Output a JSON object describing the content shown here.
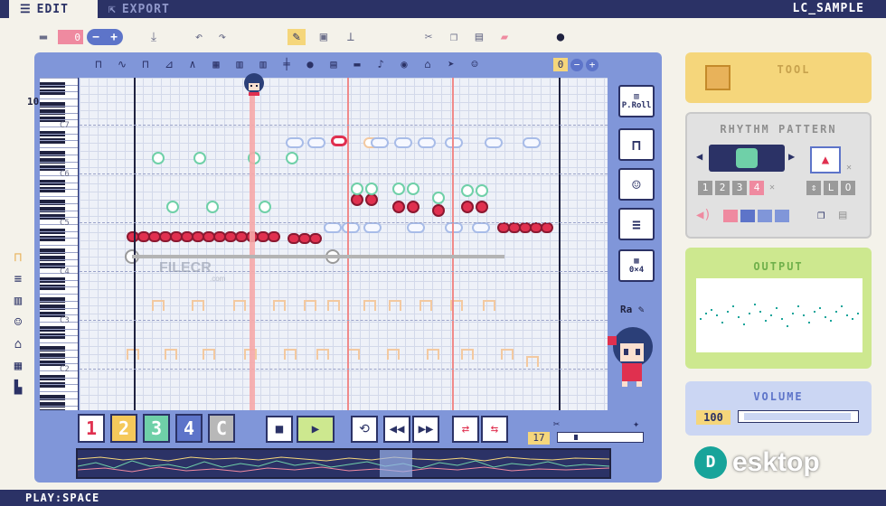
{
  "tabs": [
    {
      "label": "EDIT",
      "icon": "edit-icon",
      "active": true
    },
    {
      "label": "EXPORT",
      "icon": "export-icon",
      "active": false
    }
  ],
  "title": "LC_SAMPLE",
  "toolbar": {
    "counter_value": "0",
    "minus_label": "−",
    "plus_label": "+"
  },
  "octave_value": "0",
  "beat_marker": "10",
  "octave_labels": [
    "C7",
    "C6",
    "C5",
    "C4",
    "C3",
    "C2"
  ],
  "view_buttons": {
    "piano_roll": "P.Roll",
    "grid_size": "0×4"
  },
  "ra_label": "Ra",
  "tracks": [
    {
      "label": "1",
      "color": "#ffffff",
      "text_color": "#e0304f"
    },
    {
      "label": "2",
      "color": "#f5c95b",
      "text_color": "#ffffff"
    },
    {
      "label": "3",
      "color": "#6fd0a8",
      "text_color": "#ffffff"
    },
    {
      "label": "4",
      "color": "#5d74c9",
      "text_color": "#ffffff"
    },
    {
      "label": "C",
      "color": "#b8b8b8",
      "text_color": "#ffffff"
    }
  ],
  "tempo": "17",
  "panels": {
    "tool": "TOOL",
    "rhythm": "RHYTHM PATTERN",
    "rhythm_numbers": [
      "1",
      "2",
      "3",
      "4"
    ],
    "output": "OUTPUT",
    "volume": "VOLUME",
    "volume_value": "100"
  },
  "status": "PLAY:SPACE",
  "watermark": {
    "text": "esktop",
    "logo": "D"
  },
  "filecr": {
    "text": "FILECR",
    "sub": ".com"
  },
  "colors": {
    "navy": "#2b3266",
    "frame": "#8096d9",
    "accent_red": "#e0304f",
    "playhead": "#f6a8a8"
  }
}
